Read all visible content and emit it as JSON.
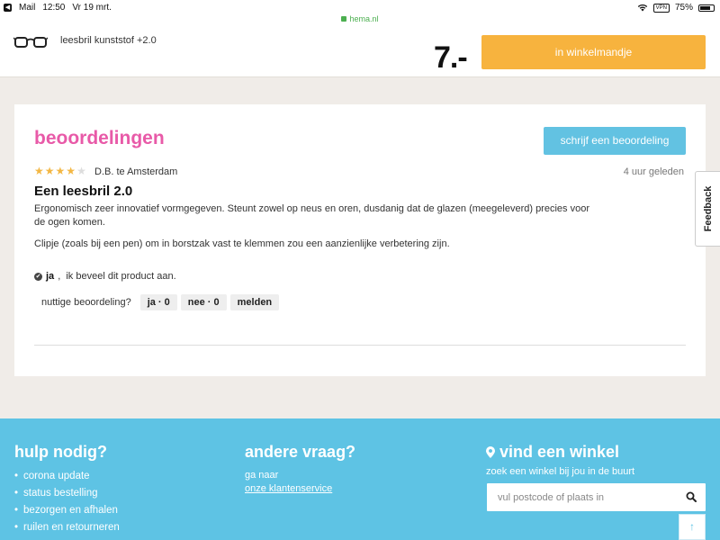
{
  "status": {
    "app": "Mail",
    "time": "12:50",
    "date": "Vr 19 mrt.",
    "vpn": "VPN",
    "battery": "75%",
    "battery_level": 0.75,
    "url": "hema.nl"
  },
  "product": {
    "name": "leesbril kunststof +2.0",
    "price": "7.-",
    "cart_label": "in winkelmandje"
  },
  "reviews": {
    "title": "beoordelingen",
    "write_label": "schrijf een beoordeling",
    "item": {
      "rating": 4,
      "rating_max": 5,
      "author": "D.B. te Amsterdam",
      "ago": "4 uur geleden",
      "title": "Een leesbril 2.0",
      "body1": "Ergonomisch zeer innovatief vormgegeven. Steunt zowel op neus en oren, dusdanig dat de glazen (meegeleverd) precies voor de ogen komen.",
      "body2": "Clipje (zoals bij een pen) om in borstzak vast te klemmen zou een aanzienlijke verbetering zijn.",
      "recommend_yes": "ja",
      "recommend_text": ",  ik beveel dit product aan.",
      "useful_q": "nuttige beoordeling?",
      "yes_label": "ja · 0",
      "no_label": "nee · 0",
      "report_label": "melden"
    }
  },
  "feedback_label": "Feedback",
  "footer": {
    "help_title": "hulp nodig?",
    "help_links": [
      "corona update",
      "status bestelling",
      "bezorgen en afhalen",
      "ruilen en retourneren"
    ],
    "other_title": "andere vraag?",
    "other_text": "ga naar",
    "other_link": "onze klantenservice",
    "store_title": "vind een winkel",
    "store_sub": "zoek een winkel bij jou in de buurt",
    "store_placeholder": "vul postcode of plaats in"
  },
  "colors": {
    "accent_pink": "#e85aa8",
    "accent_blue": "#5ec3e4",
    "cart_orange": "#f7b33e",
    "star": "#f3b744"
  }
}
